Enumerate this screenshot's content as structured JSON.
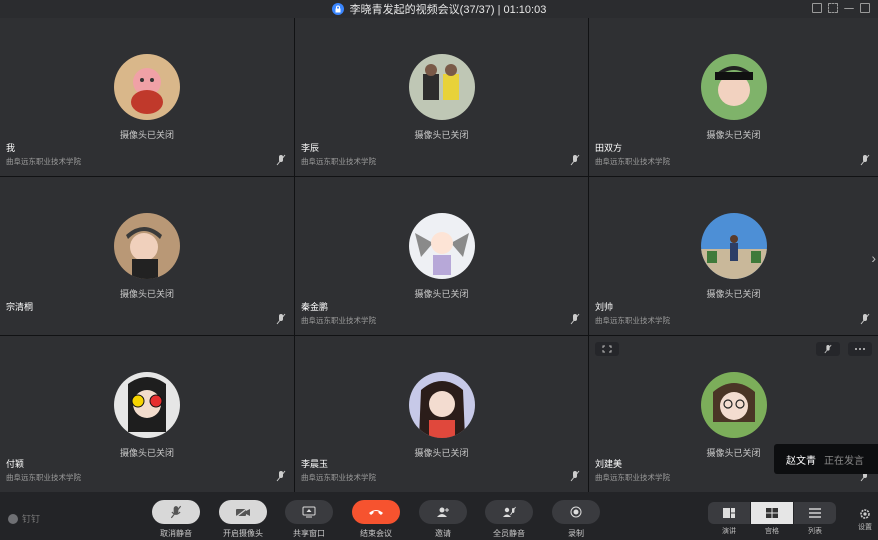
{
  "window": {
    "title": "李晓青发起的视频会议(37/37) | 01:10:03"
  },
  "camera_off_text": "摄像头已关闭",
  "participants": [
    {
      "name": "我",
      "org": "曲阜远东职业技术学院"
    },
    {
      "name": "李辰",
      "org": "曲阜远东职业技术学院"
    },
    {
      "name": "田双方",
      "org": "曲阜远东职业技术学院"
    },
    {
      "name": "宗清桐",
      "org": ""
    },
    {
      "name": "秦金鹏",
      "org": "曲阜远东职业技术学院"
    },
    {
      "name": "刘帅",
      "org": "曲阜远东职业技术学院"
    },
    {
      "name": "付颖",
      "org": "曲阜远东职业技术学院"
    },
    {
      "name": "李晨玉",
      "org": "曲阜远东职业技术学院"
    },
    {
      "name": "刘建美",
      "org": "曲阜远东职业技术学院"
    }
  ],
  "speaking": {
    "name": "赵文青",
    "status": "正在发言"
  },
  "brand": "钉钉",
  "toolbar": {
    "unmute": "取消静音",
    "camera_on": "开启摄像头",
    "share": "共享窗口",
    "end": "结束会议",
    "invite": "邀请",
    "mute_all": "全员静音",
    "record": "录制"
  },
  "layout": {
    "speaker": "演讲",
    "grid": "宫格",
    "list": "列表",
    "settings": "设置"
  },
  "colors": {
    "end_button": "#f6532f",
    "tile_bg": "#2f3033",
    "accent": "#3a86ff"
  }
}
